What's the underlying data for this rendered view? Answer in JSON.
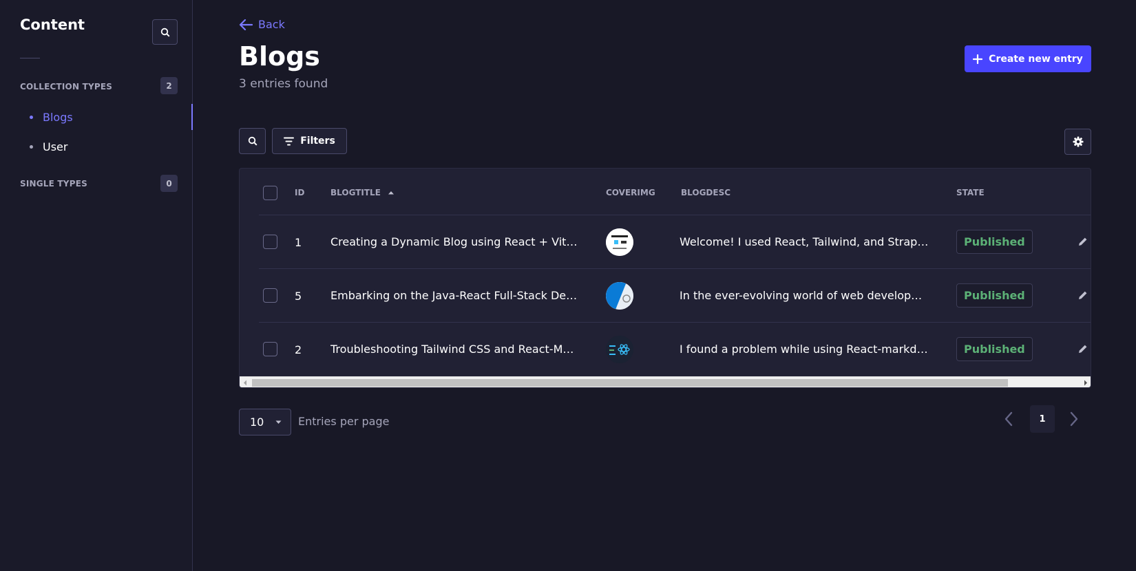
{
  "sidebar": {
    "title": "Content",
    "sections": [
      {
        "label": "COLLECTION TYPES",
        "count": "2"
      },
      {
        "label": "SINGLE TYPES",
        "count": "0"
      }
    ],
    "items": [
      {
        "label": "Blogs",
        "active": true
      },
      {
        "label": "User",
        "active": false
      }
    ]
  },
  "header": {
    "back_label": "Back",
    "title": "Blogs",
    "subtitle": "3 entries found",
    "create_label": "Create new entry"
  },
  "toolbar": {
    "filters_label": "Filters"
  },
  "table": {
    "columns": [
      "ID",
      "BLOGTITLE",
      "COVERIMG",
      "BLOGDESC",
      "STATE"
    ],
    "rows": [
      {
        "id": "1",
        "title": "Creating a Dynamic Blog using React + Vite, Tailwind and Strapi CMS",
        "cover": "cover-image-1",
        "desc": "Welcome! I used React, Tailwind, and Strapi CMS to build this blog",
        "state": "Published"
      },
      {
        "id": "5",
        "title": "Embarking on the Java-React Full-Stack Development Journey",
        "cover": "cover-image-2",
        "desc": "In the ever-evolving world of web development, full stack skills matter",
        "state": "Published"
      },
      {
        "id": "2",
        "title": "Troubleshooting Tailwind CSS and React-Markdown",
        "cover": "cover-image-3",
        "desc": "I found a problem while using React-markdown with Tailwind",
        "state": "Published"
      }
    ]
  },
  "pagination": {
    "per_page": "10",
    "per_page_label": "Entries per page",
    "current_page": "1"
  },
  "colors": {
    "accent": "#4945ff",
    "link": "#7b79ff",
    "published": "#5cb176",
    "background": "#181826"
  }
}
